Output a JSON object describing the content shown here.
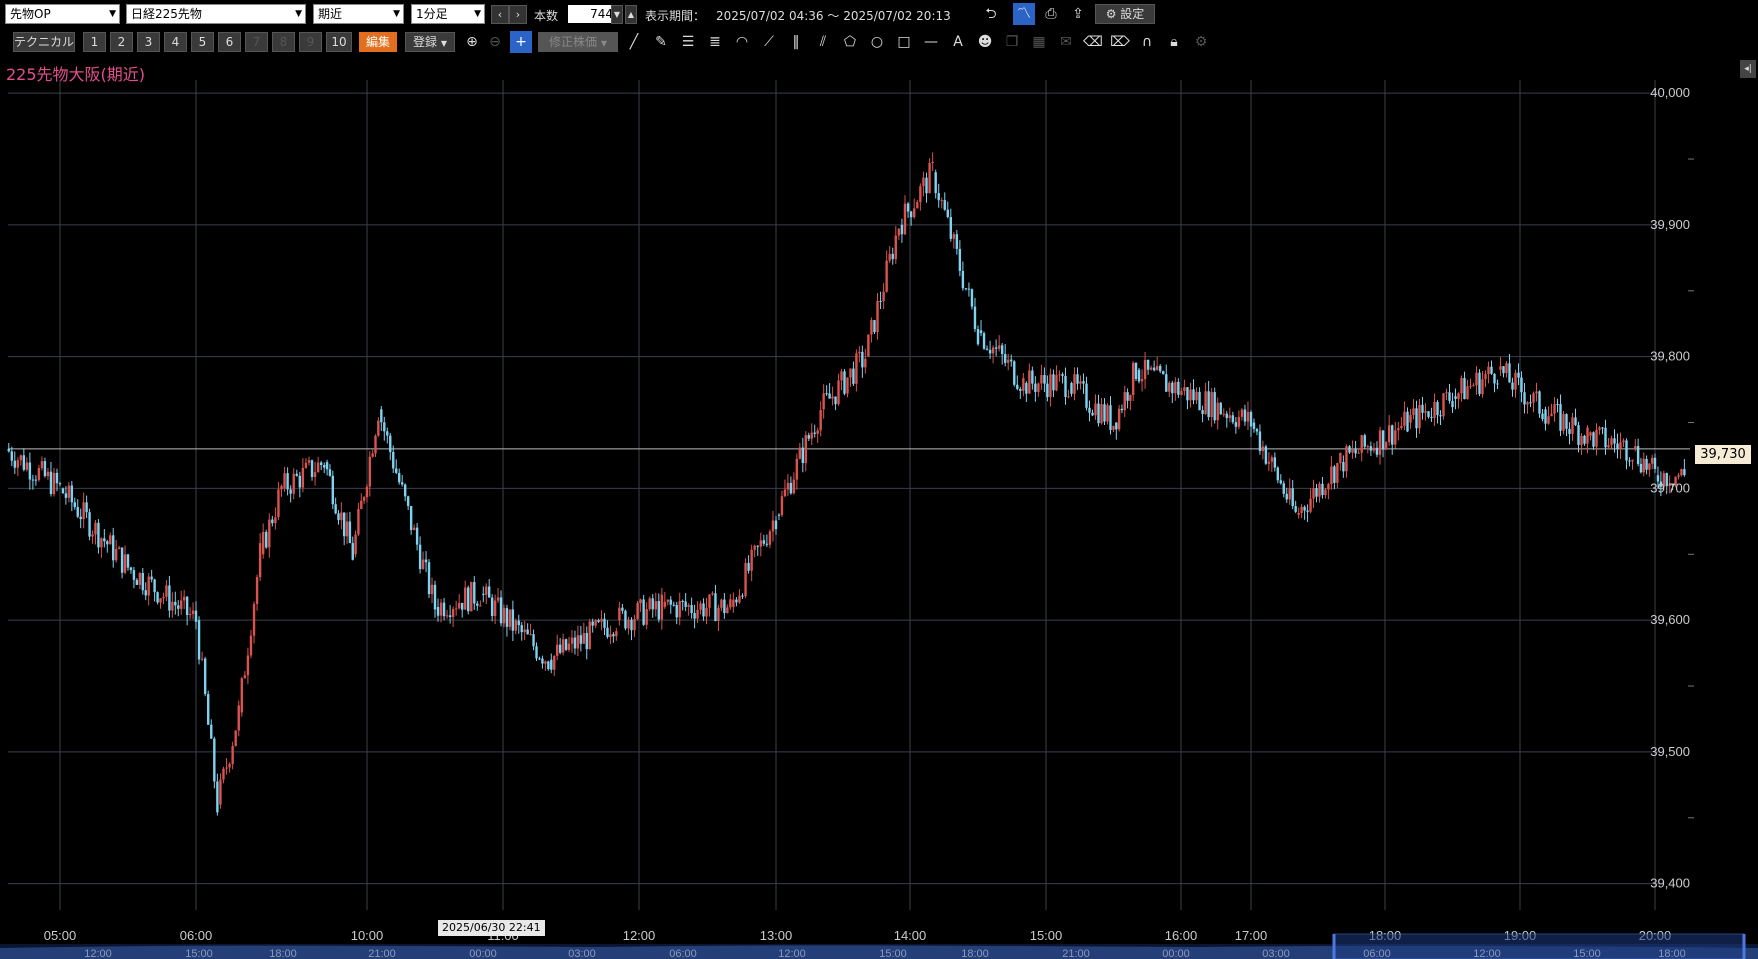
{
  "toolbar": {
    "product_select": "先物OP",
    "instrument_select": "日経225先物",
    "contract_select": "期近",
    "interval_select": "1分足",
    "prev_icon": "chevron-left-icon",
    "next_icon": "chevron-right-icon",
    "count_label": "本数",
    "count_value": "744",
    "period_label": "表示期間：",
    "period_value": "2025/07/02 04:36 ～ 2025/07/02 20:13",
    "settings_label": "設定"
  },
  "toolbar2": {
    "technical_label": "テクニカル",
    "slots": [
      "1",
      "2",
      "3",
      "4",
      "5",
      "6",
      "7",
      "8",
      "9",
      "10"
    ],
    "disabled_slots": [
      "7",
      "8",
      "9"
    ],
    "edit_label": "編集",
    "register_label": "登録",
    "adjusted_label": "修正株価"
  },
  "chart_title": "225先物大阪(期近)",
  "current_price_label": "39,730",
  "tooltip_date": "2025/06/30 22:41",
  "colors": {
    "up": "#d9534f",
    "down": "#7fd3f0",
    "grid": "#3b3f4d",
    "title": "#e24f8c",
    "accent_orange": "#e36f1e"
  },
  "chart_data": {
    "type": "line",
    "title": "225先物大阪(期近)",
    "ylim": [
      39380,
      40010
    ],
    "y_ticks": [
      "39,400",
      "39,500",
      "39,600",
      "39,700",
      "39,800",
      "39,900",
      "40,000"
    ],
    "x_ticks": [
      "05:00",
      "06:00",
      "10:00",
      "11:00",
      "12:00",
      "13:00",
      "14:00",
      "15:00",
      "16:00",
      "17:00",
      "18:00",
      "19:00",
      "20:00"
    ],
    "nav_ticks": [
      "12:00",
      "15:00",
      "18:00",
      "21:00",
      "00:00",
      "03:00",
      "06:00",
      "12:00",
      "15:00",
      "18:00",
      "21:00",
      "00:00",
      "03:00",
      "06:00",
      "12:00",
      "15:00",
      "18:00"
    ],
    "current_price": 39730,
    "series": [
      {
        "x": [
          "04:36",
          "05:00",
          "05:30",
          "06:00",
          "06:30",
          "07:00",
          "07:30",
          "08:00",
          "09:00",
          "09:40",
          "10:05",
          "10:30",
          "10:50",
          "11:20",
          "11:50",
          "12:10",
          "12:40",
          "13:00",
          "13:20",
          "13:40",
          "13:55",
          "14:10",
          "14:30",
          "14:50",
          "15:10",
          "15:30",
          "15:40",
          "17:00",
          "17:20",
          "17:40",
          "18:10",
          "18:30",
          "18:50",
          "19:10",
          "19:30",
          "19:50",
          "20:00",
          "20:13"
        ],
        "values": [
          39730,
          39700,
          39640,
          39600,
          39460,
          39530,
          39650,
          39700,
          39720,
          39650,
          39760,
          39610,
          39620,
          39570,
          39600,
          39610,
          39610,
          39680,
          39760,
          39800,
          39900,
          39940,
          39820,
          39780,
          39780,
          39750,
          39790,
          39750,
          39680,
          39720,
          39750,
          39770,
          39790,
          39760,
          39740,
          39730,
          39710,
          39710
        ]
      }
    ]
  }
}
